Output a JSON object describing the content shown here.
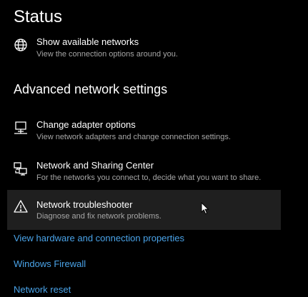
{
  "page": {
    "title": "Status"
  },
  "status": {
    "available_networks": {
      "icon": "globe-icon",
      "label": "Show available networks",
      "description": "View the connection options around you."
    }
  },
  "advanced": {
    "heading": "Advanced network settings",
    "options": [
      {
        "icon": "adapter-monitor-icon",
        "label": "Change adapter options",
        "description": "View network adapters and change connection settings."
      },
      {
        "icon": "sharing-center-icon",
        "label": "Network and Sharing Center",
        "description": "For the networks you connect to, decide what you want to share."
      },
      {
        "icon": "warning-triangle-icon",
        "label": "Network troubleshooter",
        "description": "Diagnose and fix network problems."
      }
    ]
  },
  "links": {
    "hardware_properties": "View hardware and connection properties",
    "firewall": "Windows Firewall",
    "reset": "Network reset"
  },
  "colors": {
    "background": "#000000",
    "text": "#ffffff",
    "secondary_text": "#a6a6a6",
    "link": "#4aa3e8",
    "hover_background": "#1f1f1f"
  }
}
